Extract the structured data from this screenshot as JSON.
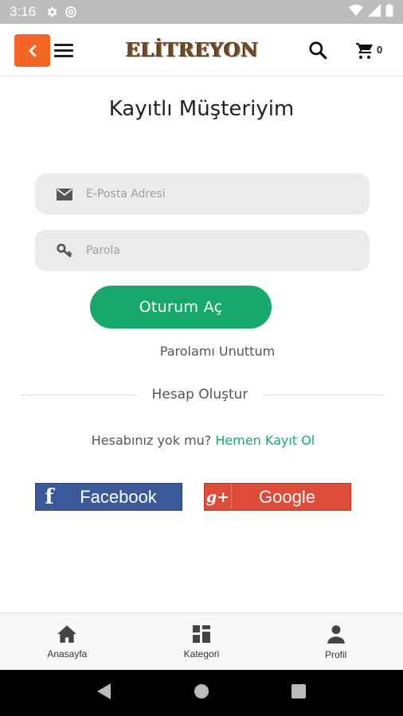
{
  "status_bar": {
    "time": "3:16",
    "icons_left": [
      "settings-icon",
      "at-sign-icon"
    ],
    "icons_right": [
      "wifi-icon",
      "signal-icon",
      "battery-icon"
    ]
  },
  "app_bar": {
    "back_icon": "chevron-left-icon",
    "menu_icon": "hamburger-menu-icon",
    "logo_text": "ELİTREYON",
    "search_icon": "search-icon",
    "cart_icon": "cart-icon",
    "cart_count": "0",
    "accent_color": "#f26522"
  },
  "login": {
    "title": "Kayıtlı Müşteriyim",
    "email": {
      "placeholder": "E-Posta Adresi",
      "value": "",
      "icon": "envelope-icon"
    },
    "password": {
      "placeholder": "Parola",
      "value": "",
      "icon": "key-icon"
    },
    "submit_label": "Oturum Aç",
    "submit_color": "#17a86b",
    "forgot_label": "Parolamı Unuttum",
    "divider_label": "Hesap Oluştur",
    "no_account_text": "Hesabınız yok mu?",
    "register_link": "Hemen Kayıt Ol"
  },
  "social": {
    "facebook": {
      "label": "Facebook",
      "icon_glyph": "f",
      "color": "#3b5998"
    },
    "google": {
      "label": "Google",
      "icon_glyph": "g+",
      "color": "#dd4b39"
    }
  },
  "bottom_nav": {
    "items": [
      {
        "label": "Anasayfa",
        "icon": "home-icon"
      },
      {
        "label": "Kategori",
        "icon": "grid-icon"
      },
      {
        "label": "Profil",
        "icon": "person-icon"
      }
    ]
  },
  "system_nav": {
    "icons": [
      "back-triangle-icon",
      "home-circle-icon",
      "recents-square-icon"
    ]
  }
}
